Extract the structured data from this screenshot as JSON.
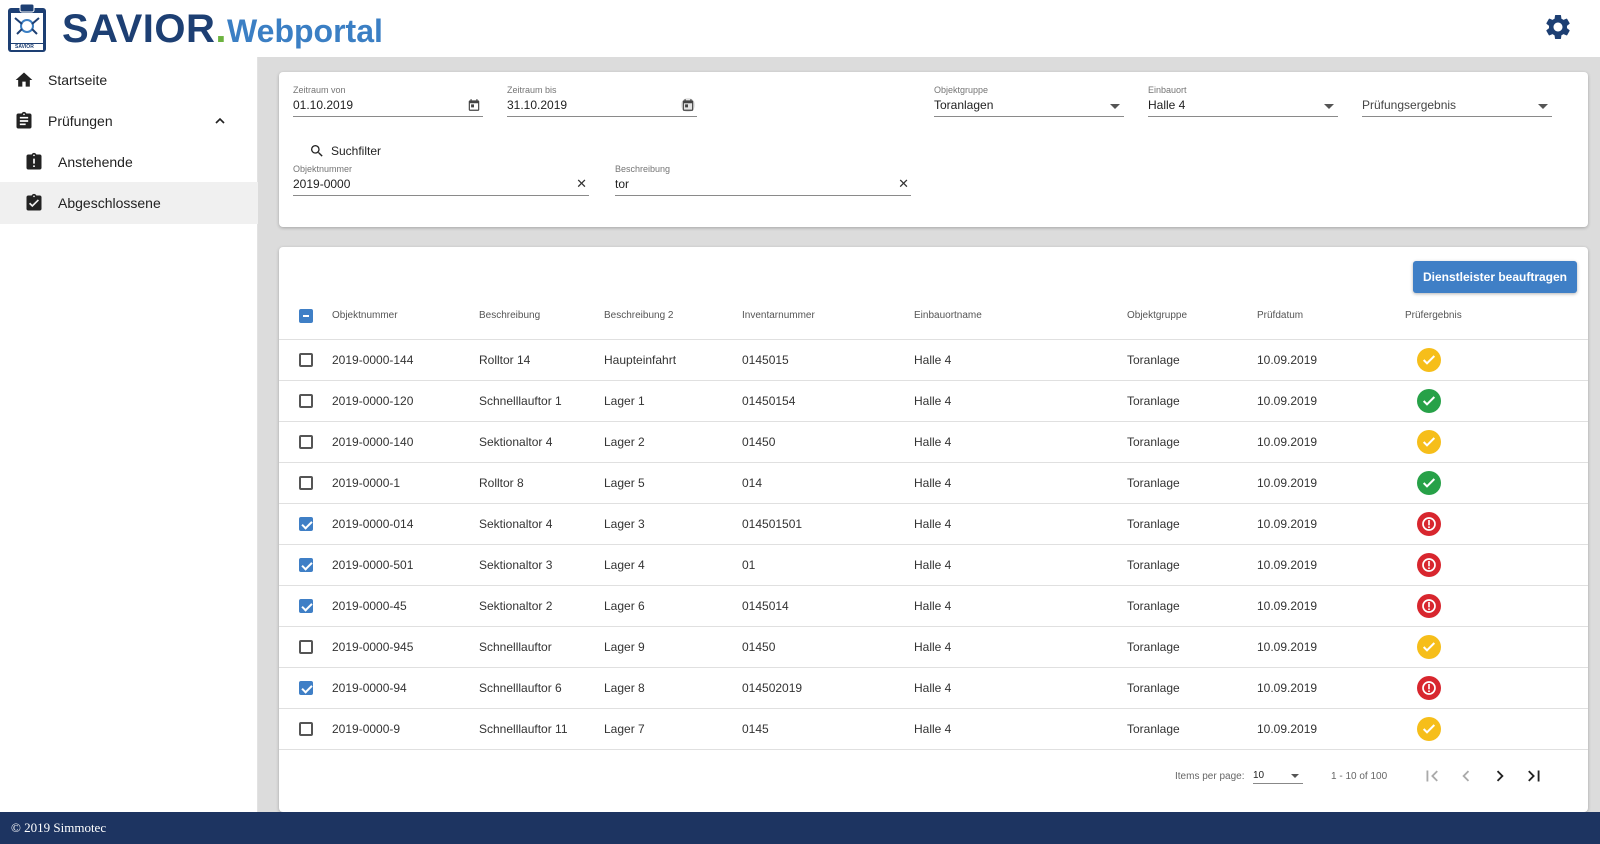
{
  "header": {
    "brand": "SAVIOR",
    "brand_dot": ".",
    "brand_sub": "Webportal",
    "logo_caption": "SAVIOR",
    "settings_icon": "gear-icon"
  },
  "sidebar": {
    "items": [
      {
        "label": "Startseite",
        "icon": "home-icon"
      },
      {
        "label": "Prüfungen",
        "icon": "clipboard-icon"
      },
      {
        "label": "Anstehende",
        "icon": "clipboard-alert-icon"
      },
      {
        "label": "Abgeschlossene",
        "icon": "clipboard-check-icon"
      }
    ]
  },
  "filters": {
    "zeitraum_von": {
      "label": "Zeitraum von",
      "value": "01.10.2019"
    },
    "zeitraum_bis": {
      "label": "Zeitraum bis",
      "value": "31.10.2019"
    },
    "objektgruppe": {
      "label": "Objektgruppe",
      "value": "Toranlagen"
    },
    "einbauort": {
      "label": "Einbauort",
      "value": "Halle 4"
    },
    "pruefungsergebnis": {
      "placeholder": "Prüfungsergebnis"
    },
    "suchfilter_label": "Suchfilter",
    "objektnummer": {
      "label": "Objektnummer",
      "value": "2019-0000"
    },
    "beschreibung": {
      "label": "Beschreibung",
      "value": "tor"
    },
    "clear_glyph": "✕"
  },
  "actions": {
    "assign_button": "Dienstleister beauftragen"
  },
  "table": {
    "columns": [
      "Objektnummer",
      "Beschreibung",
      "Beschreibung 2",
      "Inventarnummer",
      "Einbauortname",
      "Objektgruppe",
      "Prüfdatum",
      "Prüfergebnis"
    ],
    "rows": [
      {
        "checked": false,
        "objektnummer": "2019-0000-144",
        "beschreibung": "Rolltor 14",
        "beschreibung2": "Haupteinfahrt",
        "inventarnummer": "0145015",
        "einbauort": "Halle 4",
        "objektgruppe": "Toranlage",
        "pruefdatum": "10.09.2019",
        "ergebnis": "warn"
      },
      {
        "checked": false,
        "objektnummer": "2019-0000-120",
        "beschreibung": "Schnelllauftor 1",
        "beschreibung2": "Lager 1",
        "inventarnummer": "01450154",
        "einbauort": "Halle 4",
        "objektgruppe": "Toranlage",
        "pruefdatum": "10.09.2019",
        "ergebnis": "ok"
      },
      {
        "checked": false,
        "objektnummer": "2019-0000-140",
        "beschreibung": "Sektionaltor 4",
        "beschreibung2": "Lager 2",
        "inventarnummer": "01450",
        "einbauort": "Halle 4",
        "objektgruppe": "Toranlage",
        "pruefdatum": "10.09.2019",
        "ergebnis": "warn"
      },
      {
        "checked": false,
        "objektnummer": "2019-0000-1",
        "beschreibung": "Rolltor 8",
        "beschreibung2": "Lager 5",
        "inventarnummer": "014",
        "einbauort": "Halle 4",
        "objektgruppe": "Toranlage",
        "pruefdatum": "10.09.2019",
        "ergebnis": "ok"
      },
      {
        "checked": true,
        "objektnummer": "2019-0000-014",
        "beschreibung": "Sektionaltor 4",
        "beschreibung2": "Lager 3",
        "inventarnummer": "014501501",
        "einbauort": "Halle 4",
        "objektgruppe": "Toranlage",
        "pruefdatum": "10.09.2019",
        "ergebnis": "err"
      },
      {
        "checked": true,
        "objektnummer": "2019-0000-501",
        "beschreibung": "Sektionaltor 3",
        "beschreibung2": "Lager 4",
        "inventarnummer": "01",
        "einbauort": "Halle 4",
        "objektgruppe": "Toranlage",
        "pruefdatum": "10.09.2019",
        "ergebnis": "err"
      },
      {
        "checked": true,
        "objektnummer": "2019-0000-45",
        "beschreibung": "Sektionaltor 2",
        "beschreibung2": "Lager 6",
        "inventarnummer": "0145014",
        "einbauort": "Halle 4",
        "objektgruppe": "Toranlage",
        "pruefdatum": "10.09.2019",
        "ergebnis": "err"
      },
      {
        "checked": false,
        "objektnummer": "2019-0000-945",
        "beschreibung": "Schnelllauftor",
        "beschreibung2": "Lager 9",
        "inventarnummer": "01450",
        "einbauort": "Halle 4",
        "objektgruppe": "Toranlage",
        "pruefdatum": "10.09.2019",
        "ergebnis": "warn"
      },
      {
        "checked": true,
        "objektnummer": "2019-0000-94",
        "beschreibung": "Schnelllauftor 6",
        "beschreibung2": "Lager 8",
        "inventarnummer": "014502019",
        "einbauort": "Halle 4",
        "objektgruppe": "Toranlage",
        "pruefdatum": "10.09.2019",
        "ergebnis": "err"
      },
      {
        "checked": false,
        "objektnummer": "2019-0000-9",
        "beschreibung": "Schnelllauftor 11",
        "beschreibung2": "Lager 7",
        "inventarnummer": "0145",
        "einbauort": "Halle 4",
        "objektgruppe": "Toranlage",
        "pruefdatum": "10.09.2019",
        "ergebnis": "warn"
      }
    ]
  },
  "paginator": {
    "items_per_page_label": "Items per page:",
    "items_per_page": "10",
    "range_label": "1 - 10 of 100"
  },
  "footer": {
    "copyright": "© 2019 Simmotec"
  },
  "colors": {
    "brand_dark": "#1d3f73",
    "brand_light": "#3b7fc4",
    "brand_dot": "#6cb33f",
    "primary": "#3f7fc6",
    "footer_bg": "#1d3461",
    "status_ok": "#27a148",
    "status_warn": "#f6be1a",
    "status_err": "#d8262e"
  }
}
